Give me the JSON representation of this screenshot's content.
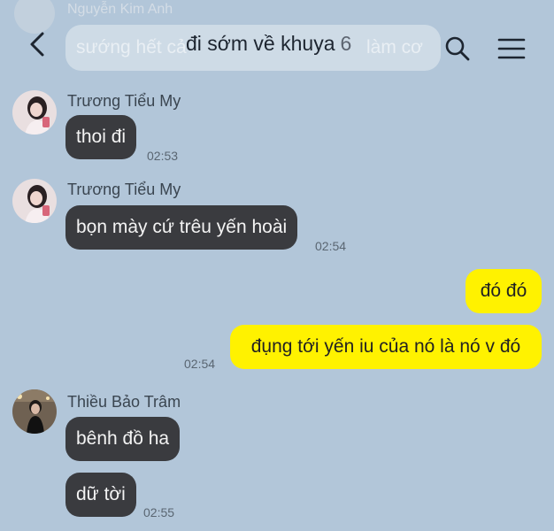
{
  "header": {
    "title": "đi sớm về khuya",
    "member_count": "6",
    "pinned_sender": "Nguyễn Kim Anh",
    "pinned_preview": "sướng hết cả",
    "pinned_preview_end": "làm cơ"
  },
  "messages": [
    {
      "sender": "Trương Tiểu My",
      "text": "thoi đi",
      "time": "02:53"
    },
    {
      "sender": "Trương Tiểu My",
      "text": "bọn mày cứ trêu yến hoài",
      "time": "02:54"
    },
    {
      "text": "đó đó"
    },
    {
      "text": "đụng tới yến iu của nó là nó v đó",
      "time": "02:54"
    },
    {
      "sender": "Thiều Bảo Trâm",
      "text": "bênh đồ ha"
    },
    {
      "text": "dữ tời",
      "time": "02:55"
    }
  ],
  "colors": {
    "background": "#b2c6d9",
    "incoming_bubble": "#3a3b3f",
    "outgoing_bubble": "#fff200"
  },
  "icons": [
    "back-arrow-icon",
    "search-icon",
    "menu-icon"
  ]
}
